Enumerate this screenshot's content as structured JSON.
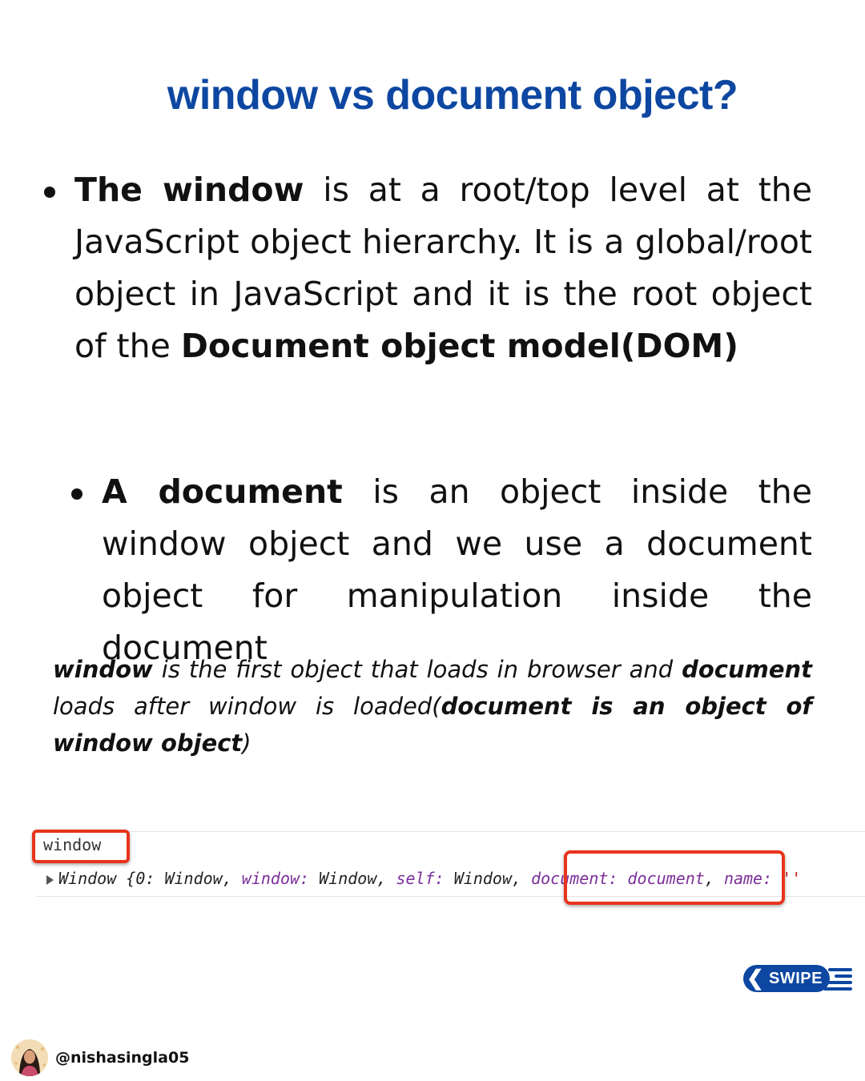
{
  "title": {
    "part1": "window",
    "part2": " vs ",
    "part3": "document",
    "part4": " object?"
  },
  "bullet1": {
    "bold_lead": "The window",
    "text1": " is at a root/top level at the JavaScript object hierarchy. It  is a global/root object in JavaScript and it is the root object of the ",
    "bold_end": "Document object model(DOM)"
  },
  "bullet2": {
    "bold_lead": "A document",
    "text1": " is an object inside the window object and we use a document object for manipulation inside the document"
  },
  "note": {
    "b1": "window",
    "t1": " is the first object that loads in browser and ",
    "b2": "document",
    "t2": " loads after window is loaded(",
    "b3": "document is an object of window object",
    "t3": ")"
  },
  "console": {
    "prompt": "window",
    "output_prefix": "Window {0: ",
    "o_val1": "Window",
    "o_sep1": ", ",
    "o_key2": "window:",
    "o_val2": " Window",
    "o_sep2": ", ",
    "o_key3": "self:",
    "o_val3": " Window",
    "o_sep3": ", ",
    "o_key4": "document:",
    "o_val4": " document",
    "o_sep4": ", ",
    "o_key5": "name:",
    "o_val5": " ''"
  },
  "swipe": {
    "label": "SWIPE",
    "chevron": "❮"
  },
  "handle": "@nishasingla05",
  "colors": {
    "title_blue": "#0d47a1",
    "highlight_red": "#e8341c",
    "text": "#111111"
  }
}
